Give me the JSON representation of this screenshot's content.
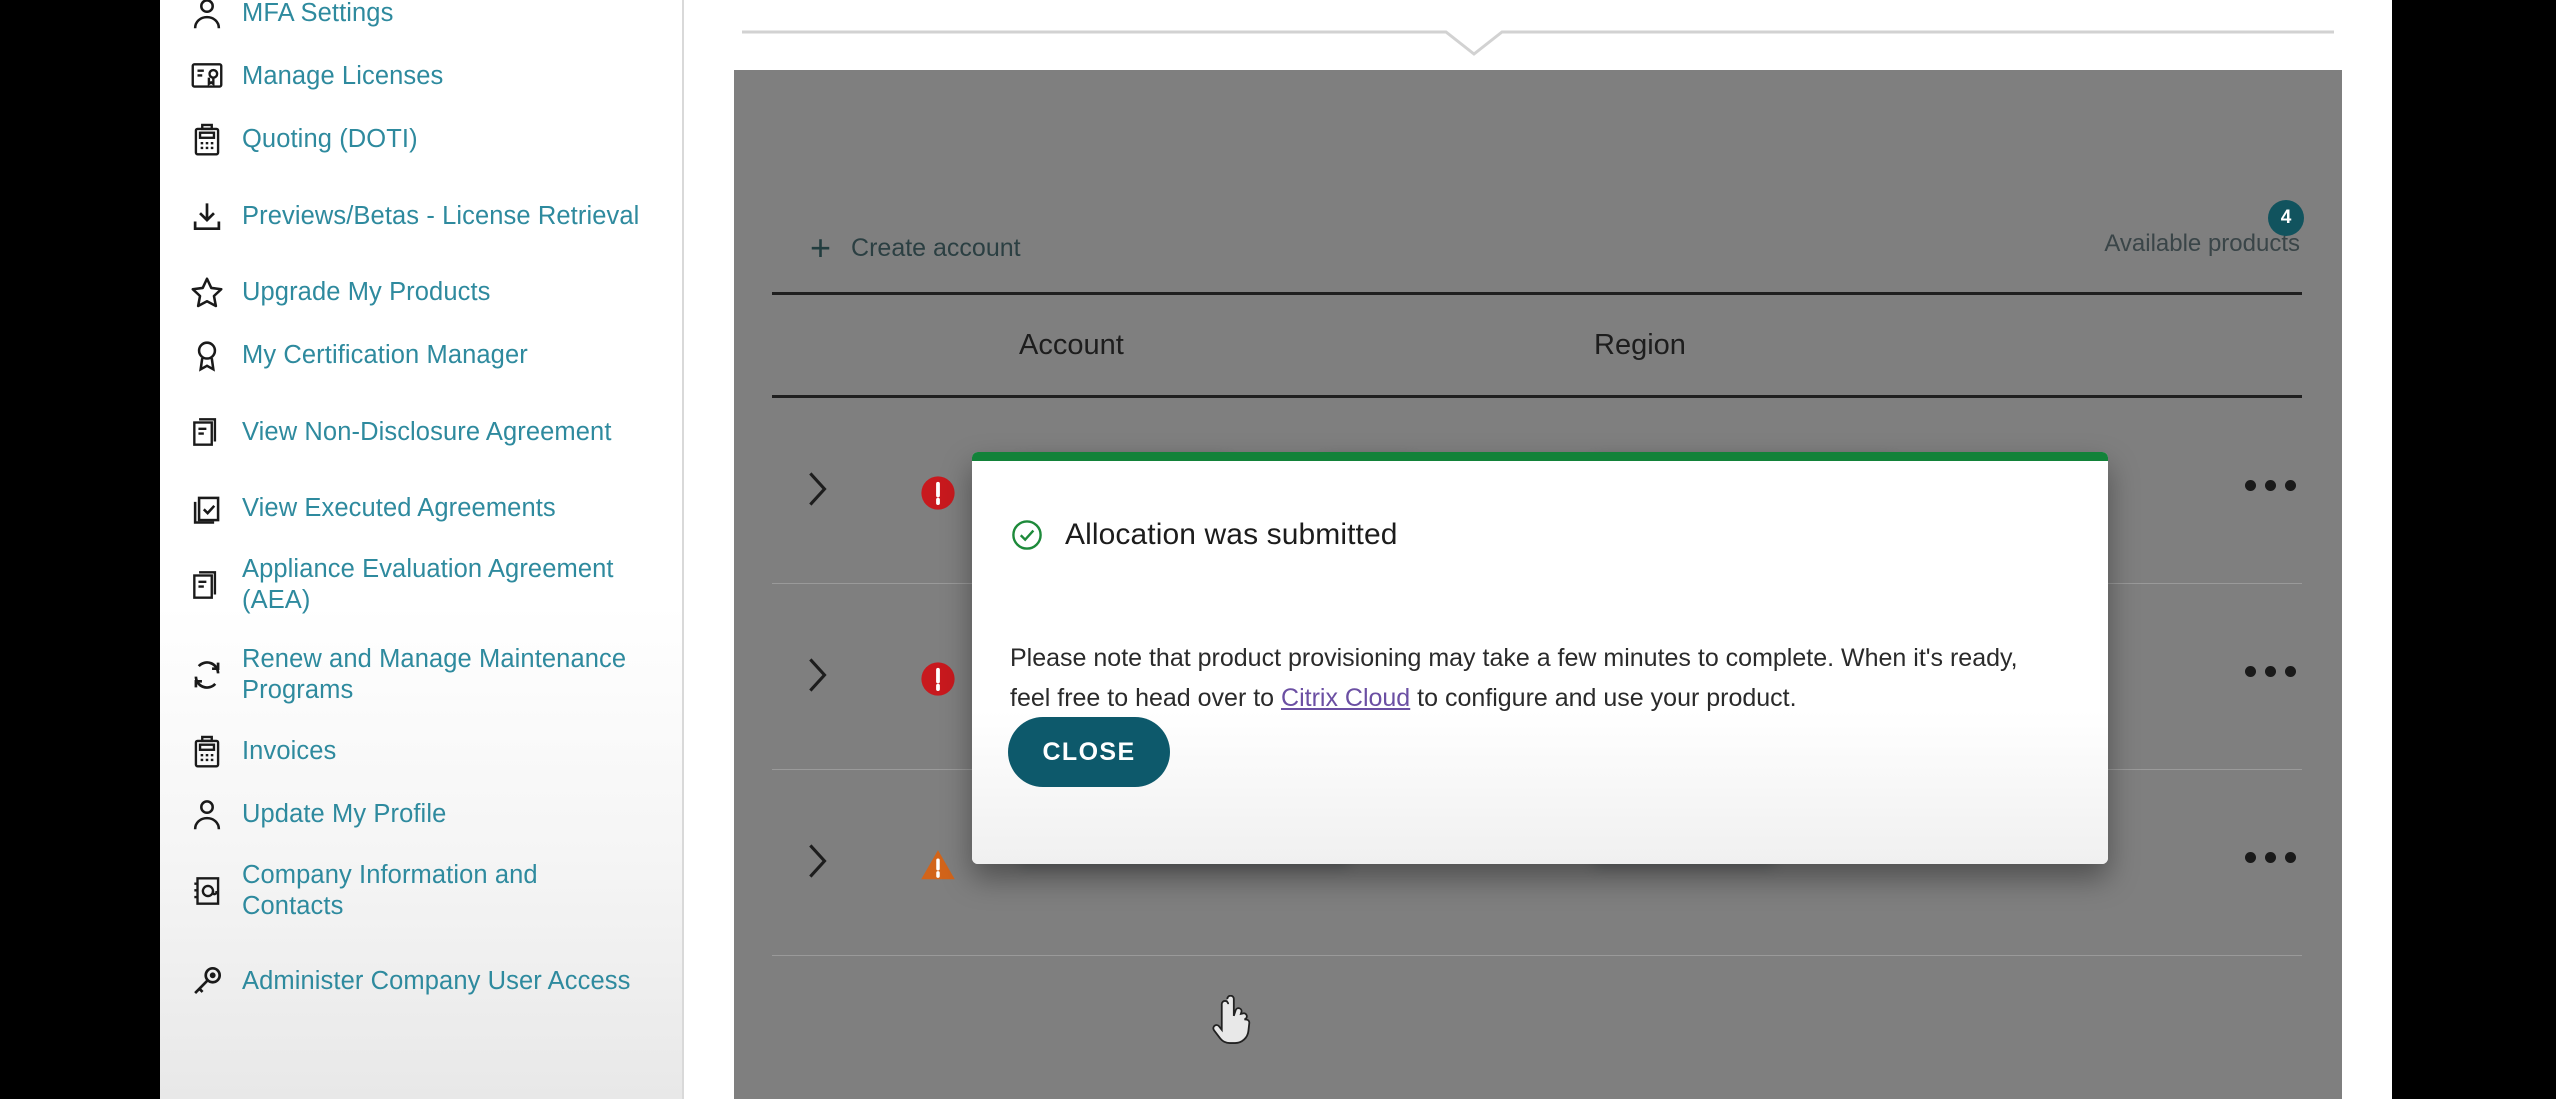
{
  "sidebar": {
    "items": [
      {
        "label": "MFA Settings",
        "icon": "person-icon",
        "two_line": false
      },
      {
        "label": "Manage Licenses",
        "icon": "license-certificate-icon",
        "two_line": false
      },
      {
        "label": "Quoting (DOTI)",
        "icon": "calculator-icon",
        "two_line": false
      },
      {
        "label": "Previews/Betas - License Retrieval",
        "icon": "download-icon",
        "two_line": true
      },
      {
        "label": "Upgrade My Products",
        "icon": "star-icon",
        "two_line": false
      },
      {
        "label": "My Certification Manager",
        "icon": "award-badge-icon",
        "two_line": false
      },
      {
        "label": "View Non-Disclosure Agreement",
        "icon": "documents-icon",
        "two_line": true
      },
      {
        "label": "View Executed Agreements",
        "icon": "checked-document-icon",
        "two_line": false
      },
      {
        "label": "Appliance Evaluation Agreement (AEA)",
        "icon": "documents-icon",
        "two_line": true
      },
      {
        "label": "Renew and Manage Maintenance Programs",
        "icon": "refresh-cycle-icon",
        "two_line": true
      },
      {
        "label": "Invoices",
        "icon": "calculator-icon",
        "two_line": false
      },
      {
        "label": "Update My Profile",
        "icon": "person-icon",
        "two_line": false
      },
      {
        "label": "Company Information and Contacts",
        "icon": "contact-book-icon",
        "two_line": true
      },
      {
        "label": "Administer Company User Access",
        "icon": "key-icon",
        "two_line": true
      }
    ]
  },
  "main": {
    "create_account_label": "Create account",
    "available_products_label": "Available products",
    "available_products_count": "4",
    "table": {
      "columns": [
        "Account",
        "Region"
      ],
      "rows": [
        {
          "status": "error-icon",
          "account": "",
          "region": "",
          "menu": "more-options-icon"
        },
        {
          "status": "error-icon",
          "account": "",
          "region": "",
          "menu": "more-options-icon"
        },
        {
          "status": "warning-icon",
          "account": "",
          "region": "",
          "menu": "more-options-icon"
        }
      ]
    }
  },
  "modal": {
    "title": "Allocation was submitted",
    "body_before_link": "Please note that product provisioning may take a few minutes to complete. When it's ready, feel free to head over to ",
    "link_label": "Citrix Cloud",
    "body_after_link": " to configure and use your product.",
    "close_label": "CLOSE",
    "accent_color": "#128239",
    "close_button_color": "#0d596b"
  },
  "colors": {
    "sidebar_link": "#2e8a9e",
    "badge_teal": "#11535e",
    "overlay_grey": "#7f7f7f",
    "error_red": "#c8191e",
    "warning_orange": "#d2641a"
  }
}
